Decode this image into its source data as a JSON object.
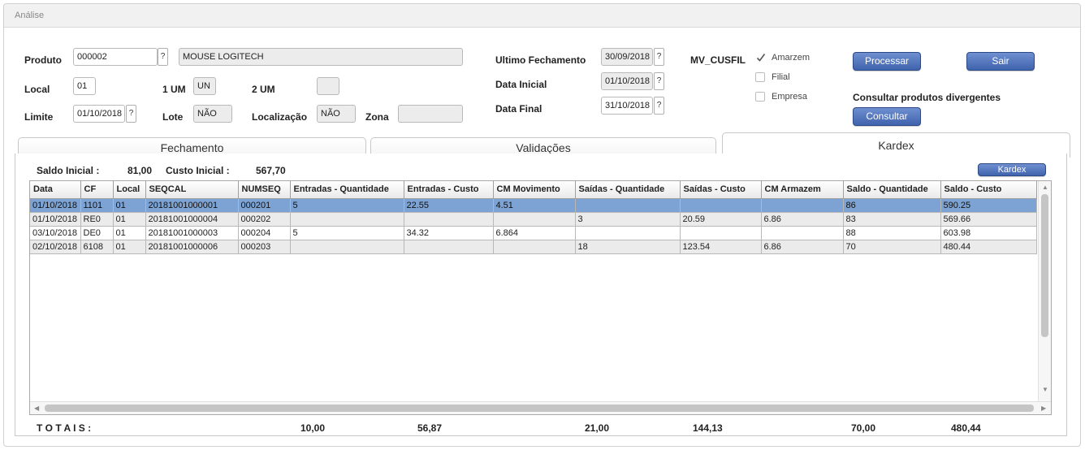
{
  "window": {
    "title": "Análise"
  },
  "form": {
    "produto_label": "Produto",
    "produto_code": "000002",
    "produto_desc": "MOUSE LOGITECH",
    "local_label": "Local",
    "local_value": "01",
    "um1_label": "1 UM",
    "um1_value": "UN",
    "um2_label": "2 UM",
    "um2_value": "",
    "limite_label": "Limite",
    "limite_value": "01/10/2018",
    "lote_label": "Lote",
    "lote_value": "NÃO",
    "localizacao_label": "Localização",
    "localizacao_value": "NÃO",
    "zona_label": "Zona",
    "zona_value": "",
    "ultimo_fech_label": "Ultimo Fechamento",
    "ultimo_fech_value": "30/09/2018",
    "data_inicial_label": "Data Inicial",
    "data_inicial_value": "01/10/2018",
    "data_final_label": "Data Final",
    "data_final_value": "31/10/2018",
    "lookup_glyph": "?",
    "mv_cusfil_label": "MV_CUSFIL",
    "opt_amarzem": "Amarzem",
    "opt_filial": "Filial",
    "opt_empresa": "Empresa",
    "processar_label": "Processar",
    "sair_label": "Sair",
    "divergentes_label": "Consultar produtos divergentes",
    "consultar_label": "Consultar"
  },
  "tabs": [
    {
      "label": "Fechamento"
    },
    {
      "label": "Validações"
    },
    {
      "label": "Kardex"
    }
  ],
  "kardex": {
    "saldo_inicial_label": "Saldo Inicial :",
    "saldo_inicial_value": "81,00",
    "custo_inicial_label": "Custo Inicial :",
    "custo_inicial_value": "567,70",
    "kardex_button": "Kardex",
    "columns": [
      "Data",
      "CF",
      "Local",
      "SEQCAL",
      "NUMSEQ",
      "Entradas - Quantidade",
      "Entradas - Custo",
      "CM Movimento",
      "Saídas - Quantidade",
      "Saídas - Custo",
      "CM Armazem",
      "Saldo - Quantidade",
      "Saldo - Custo"
    ],
    "rows": [
      [
        "01/10/2018",
        "1101",
        "01",
        "20181001000001",
        "000201",
        "5",
        "22.55",
        "4.51",
        "",
        "",
        "",
        "86",
        "590.25"
      ],
      [
        "01/10/2018",
        "RE0",
        "01",
        "20181001000004",
        "000202",
        "",
        "",
        "",
        "3",
        "20.59",
        "6.86",
        "83",
        "569.66"
      ],
      [
        "03/10/2018",
        "DE0",
        "01",
        "20181001000003",
        "000204",
        "5",
        "34.32",
        "6.864",
        "",
        "",
        "",
        "88",
        "603.98"
      ],
      [
        "02/10/2018",
        "6108",
        "01",
        "20181001000006",
        "000203",
        "",
        "",
        "",
        "18",
        "123.54",
        "6.86",
        "70",
        "480.44"
      ]
    ],
    "totals_label": "T O T A I S :",
    "totals": {
      "entradas_qtd": "10,00",
      "entradas_custo": "56,87",
      "saidas_qtd": "21,00",
      "saidas_custo": "144,13",
      "saldo_qtd": "70,00",
      "saldo_custo": "480,44"
    }
  },
  "colors": {
    "accent": "#4a6cb5",
    "selected_row": "#7ca3d3"
  }
}
